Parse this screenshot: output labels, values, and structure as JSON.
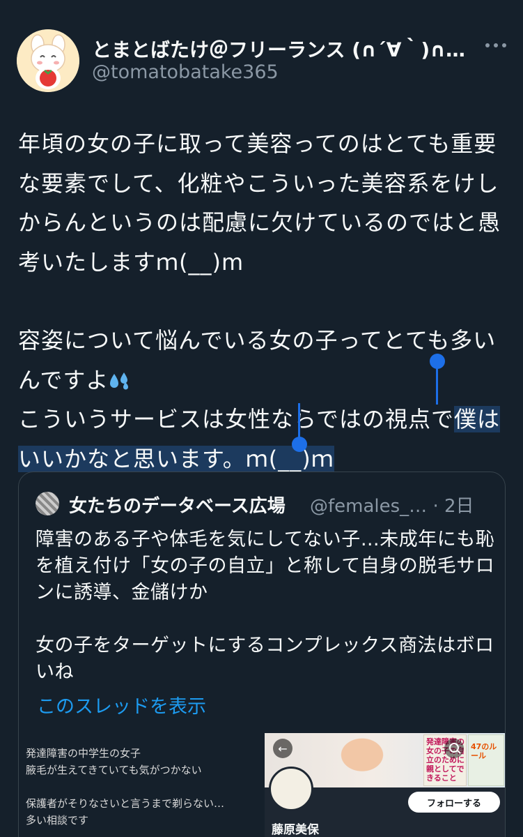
{
  "tweet": {
    "display_name": "とまとばたけ＠フリーランス (∩´∀｀)∩な…",
    "handle": "@tomatobatake365",
    "para1": "年頃の女の子に取って美容ってのはとても重要な要素でして、化粧やこういった美容系をけしからんというのは配慮に欠けているのではと愚考いたしますｍ(__)m",
    "para2a": "容姿について悩んでいる女の子ってとても多いんですよ",
    "para2b_pre": "こういうサービスは女性ならではの視点で",
    "para2b_sel": "僕はいいかなと思います。ｍ(__)ｍ"
  },
  "quote": {
    "name": "女たちのデータベース広場",
    "handle": "@females_… · 2日",
    "text1": "障害のある子や体毛を気にしてない子…未成年にも恥を植え付け「女の子の自立」と称して自身の脱毛サロンに誘導、金儲けか",
    "text2": "女の子をターゲットにするコンプレックス商法はボロいね",
    "show_thread": "このスレッドを表示"
  },
  "media": {
    "left_lines": [
      "発達障害の中学生の女子",
      "腋毛が生えてきていても気がつかない",
      "保護者がそりなさいと言うまで剃らない…",
      "多い相談です"
    ],
    "book1_text": "発達障害の女の子の自立のために親としてできること",
    "book2_text": "47のルール",
    "follow_label": "フォローする",
    "profile_name": "藤原美保"
  },
  "colors": {
    "background": "#15202b",
    "link": "#1d9bf0",
    "selection_handle": "#1d6fe8"
  }
}
